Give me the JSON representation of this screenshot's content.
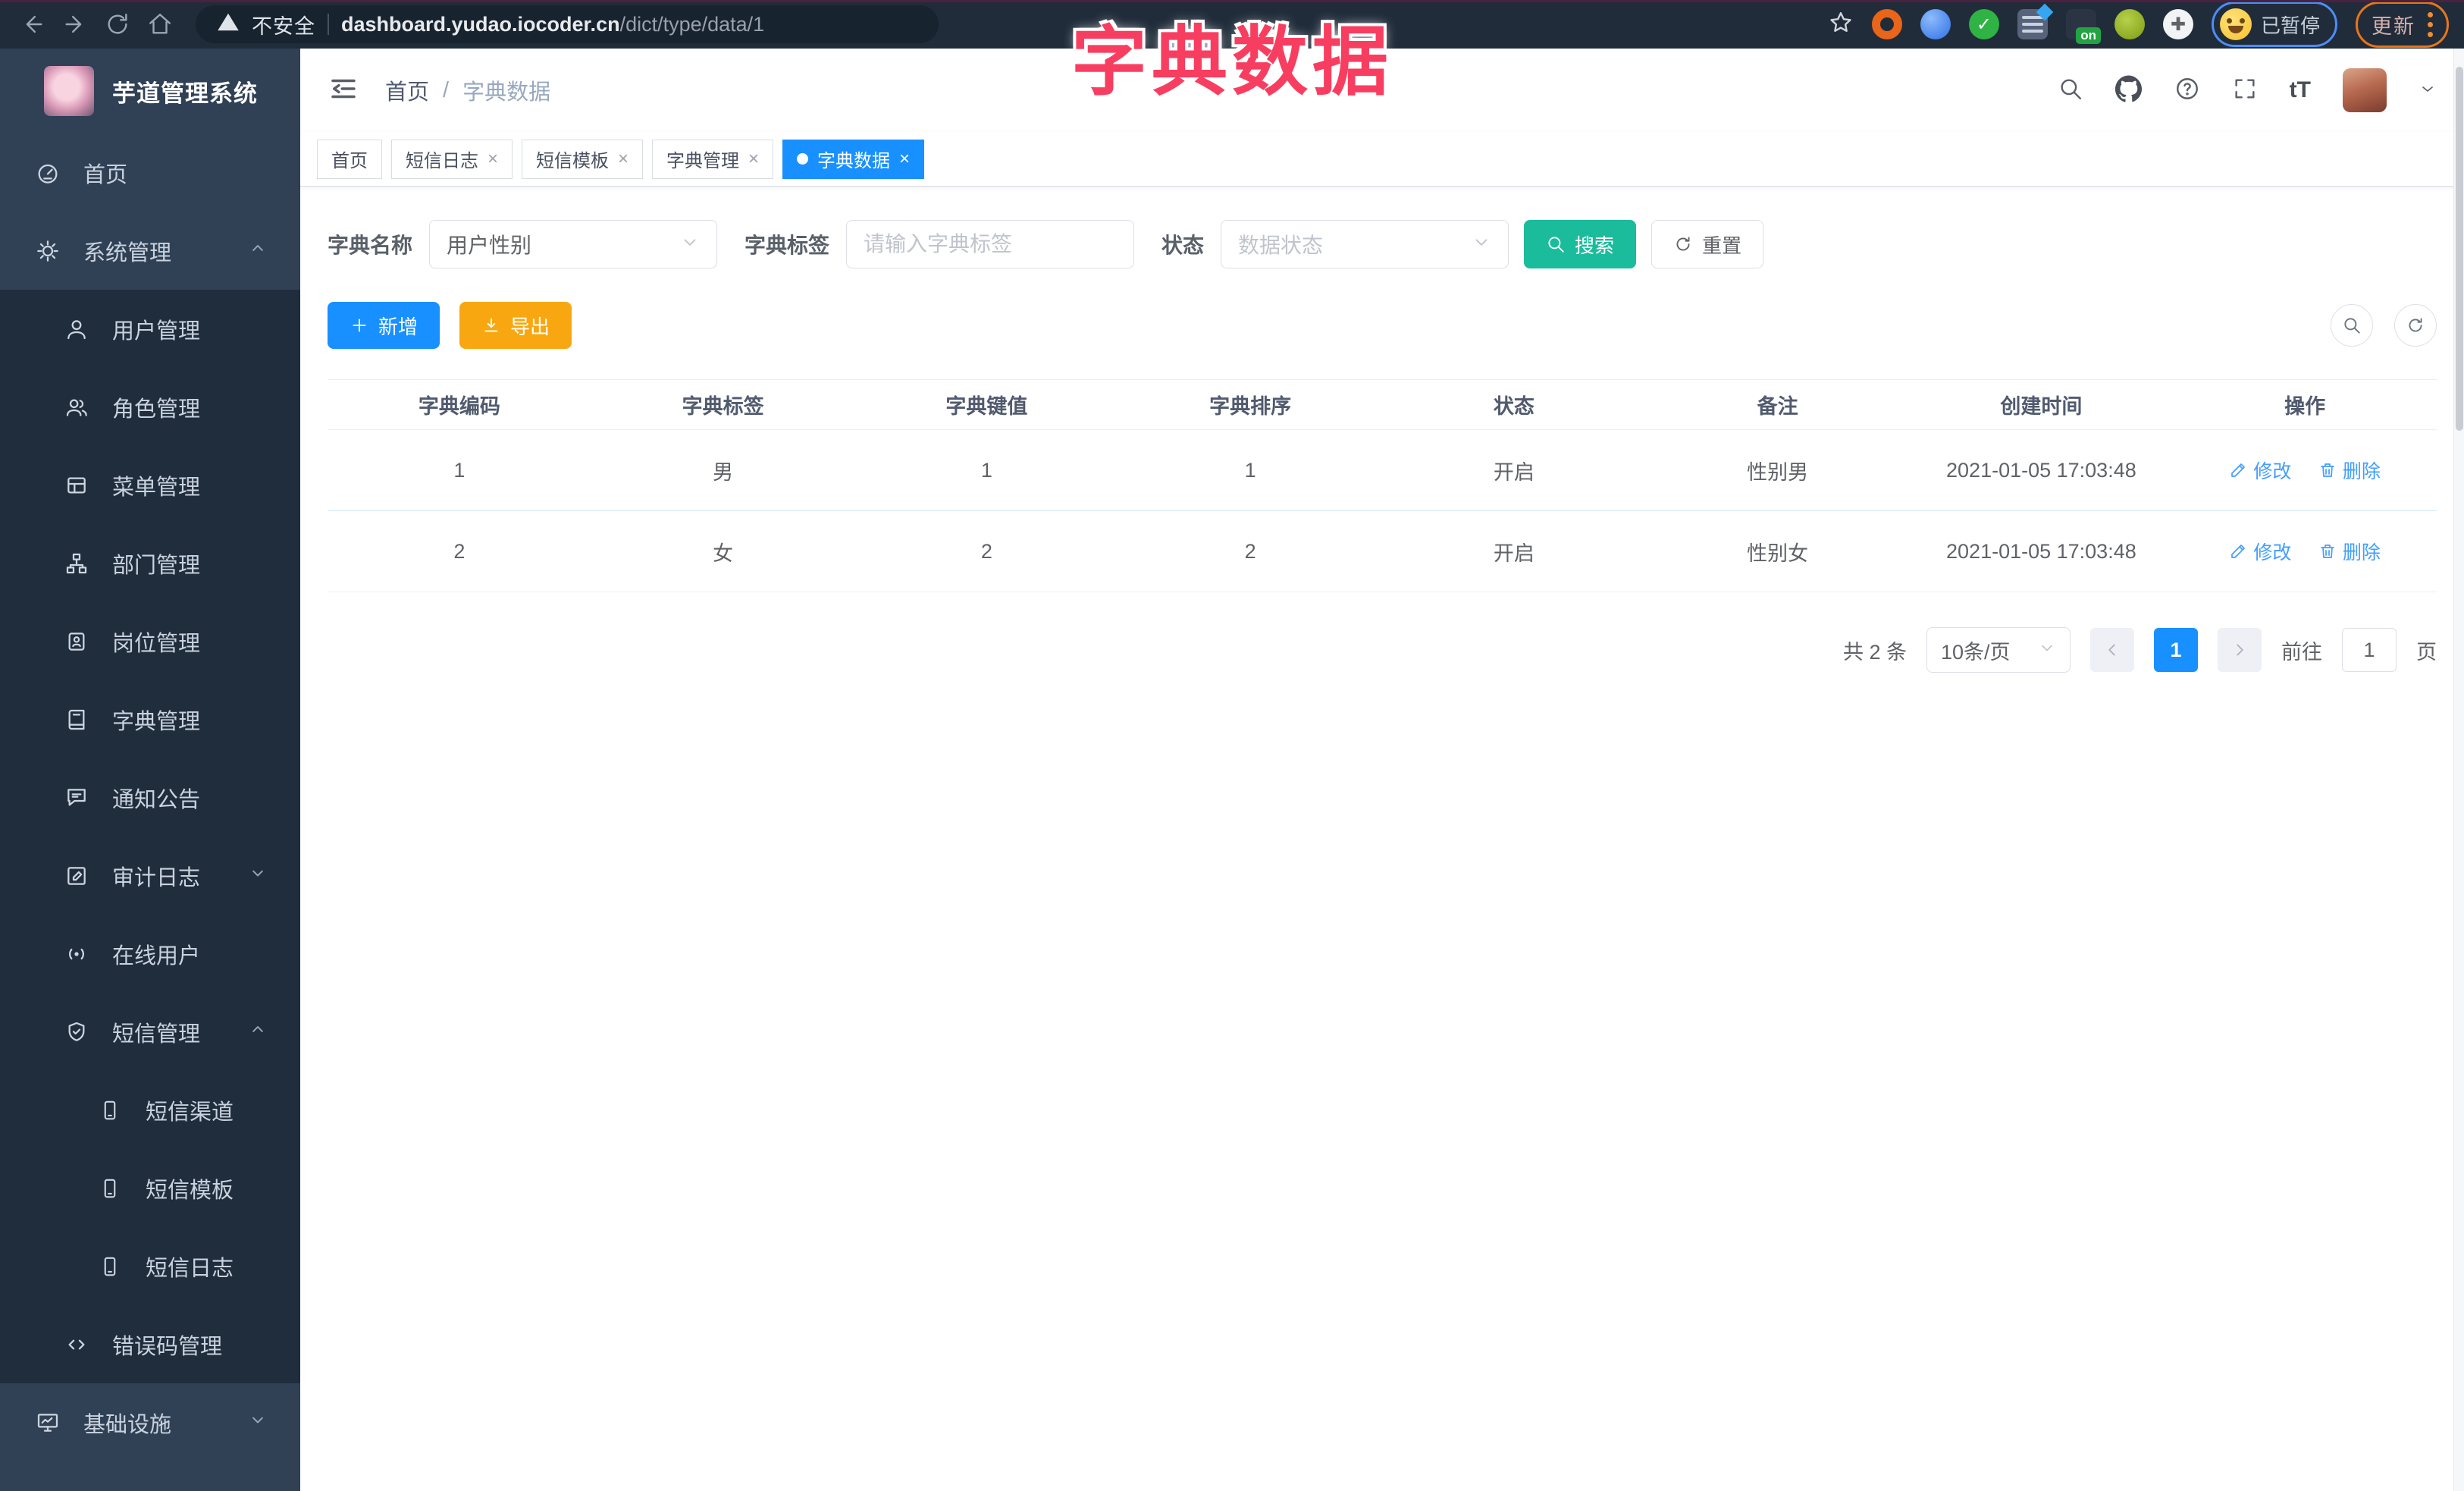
{
  "browser": {
    "security_label": "不安全",
    "url_host": "dashboard.yudao.iocoder.cn",
    "url_path": "/dict/type/data/1",
    "on_badge": "on",
    "paused_label": "已暂停",
    "update_label": "更新"
  },
  "overlay_title": "字典数据",
  "sidebar": {
    "app_title": "芋道管理系统",
    "items": [
      {
        "label": "首页"
      },
      {
        "label": "系统管理"
      },
      {
        "label": "用户管理"
      },
      {
        "label": "角色管理"
      },
      {
        "label": "菜单管理"
      },
      {
        "label": "部门管理"
      },
      {
        "label": "岗位管理"
      },
      {
        "label": "字典管理"
      },
      {
        "label": "通知公告"
      },
      {
        "label": "审计日志"
      },
      {
        "label": "在线用户"
      },
      {
        "label": "短信管理"
      },
      {
        "label": "短信渠道"
      },
      {
        "label": "短信模板"
      },
      {
        "label": "短信日志"
      },
      {
        "label": "错误码管理"
      },
      {
        "label": "基础设施"
      }
    ]
  },
  "header": {
    "breadcrumb_home": "首页",
    "breadcrumb_sep": "/",
    "breadcrumb_current": "字典数据"
  },
  "tabs": [
    {
      "label": "首页"
    },
    {
      "label": "短信日志"
    },
    {
      "label": "短信模板"
    },
    {
      "label": "字典管理"
    },
    {
      "label": "字典数据"
    }
  ],
  "filters": {
    "dict_name_label": "字典名称",
    "dict_name_value": "用户性别",
    "dict_label_label": "字典标签",
    "dict_label_placeholder": "请输入字典标签",
    "status_label": "状态",
    "status_placeholder": "数据状态",
    "search_label": "搜索",
    "reset_label": "重置"
  },
  "toolbar": {
    "add_label": "新增",
    "export_label": "导出"
  },
  "table": {
    "headers": [
      "字典编码",
      "字典标签",
      "字典键值",
      "字典排序",
      "状态",
      "备注",
      "创建时间",
      "操作"
    ],
    "edit_label": "修改",
    "delete_label": "删除",
    "rows": [
      {
        "code": "1",
        "label": "男",
        "value": "1",
        "sort": "1",
        "status": "开启",
        "remark": "性别男",
        "created": "2021-01-05 17:03:48"
      },
      {
        "code": "2",
        "label": "女",
        "value": "2",
        "sort": "2",
        "status": "开启",
        "remark": "性别女",
        "created": "2021-01-05 17:03:48"
      }
    ]
  },
  "pagination": {
    "total_label": "共 2 条",
    "page_size_value": "10条/页",
    "current_page": "1",
    "goto_label": "前往",
    "goto_value": "1",
    "page_unit_label": "页"
  }
}
